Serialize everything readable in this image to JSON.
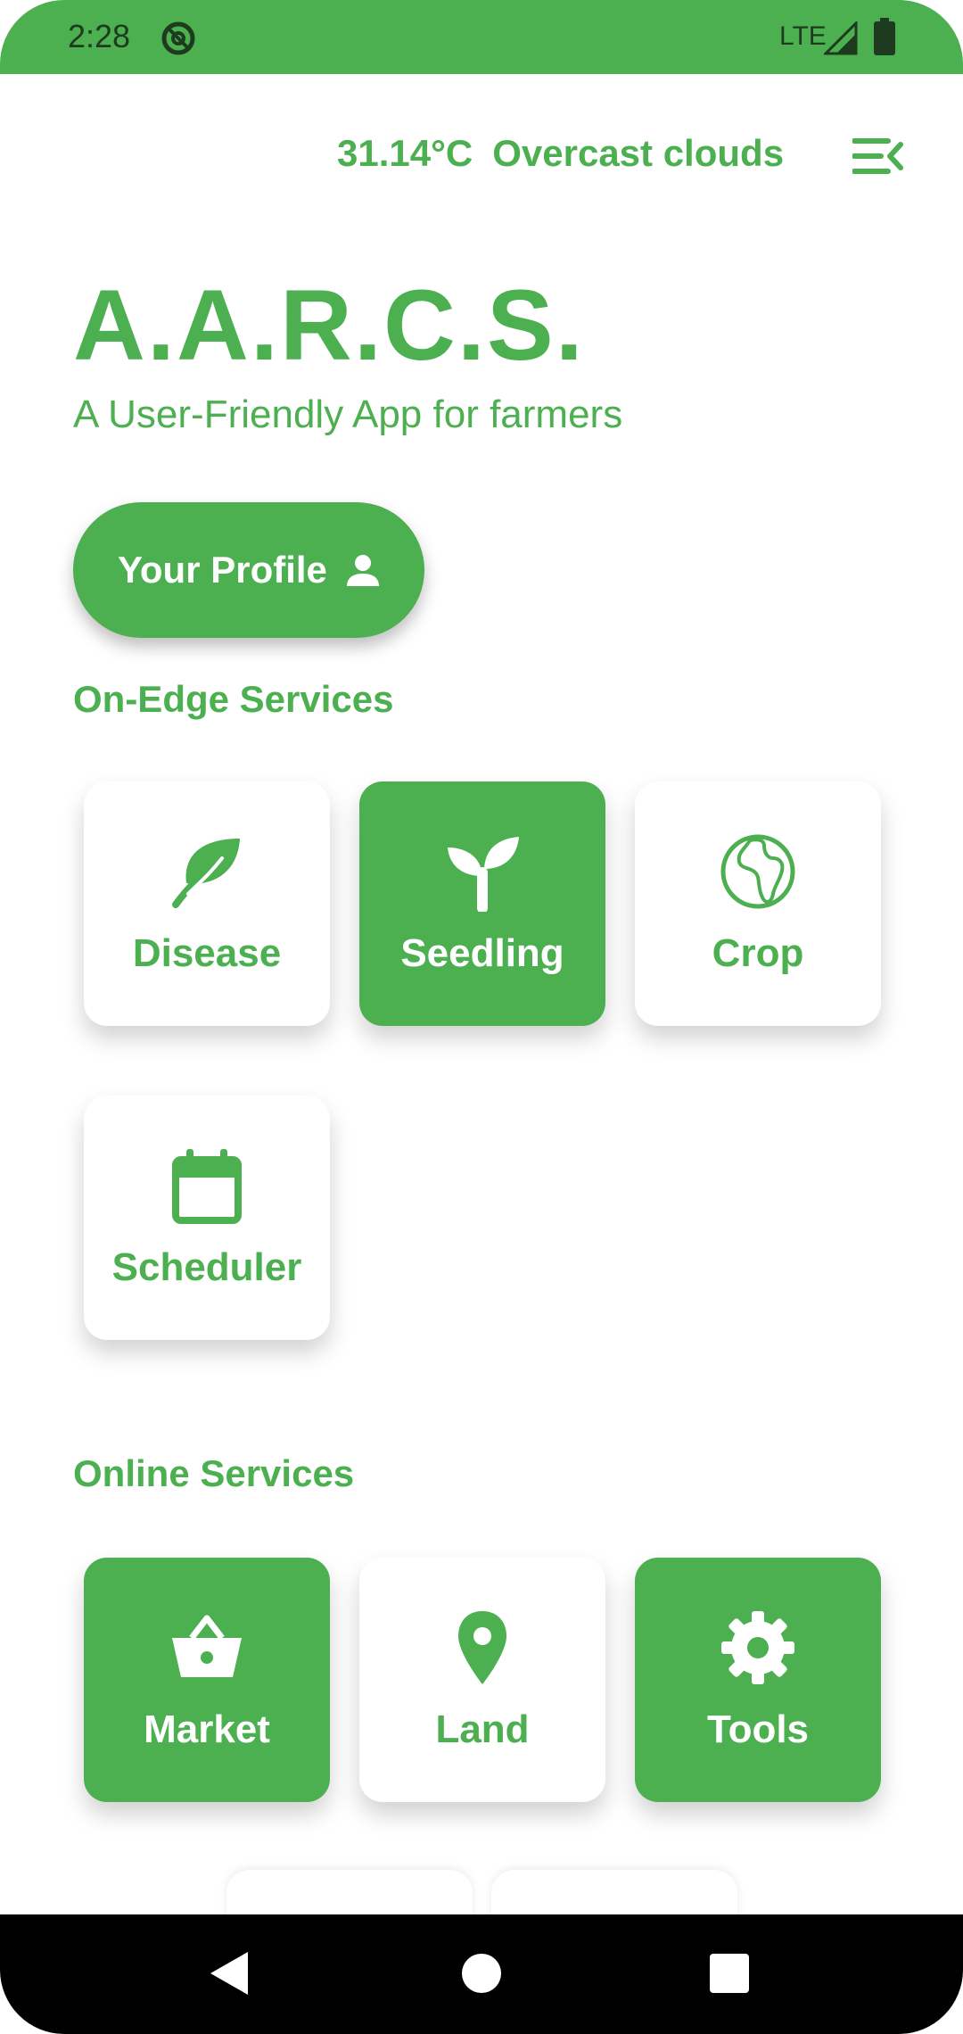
{
  "status_bar": {
    "time": "2:28",
    "network": "LTE",
    "icons": [
      "do-not-disturb-icon",
      "signal-icon",
      "battery-icon"
    ]
  },
  "header": {
    "temperature": "31.14°C",
    "condition": "Overcast clouds",
    "menu_icon": "menu-collapse-icon"
  },
  "app": {
    "title": "A.A.R.C.S.",
    "subtitle": "A User-Friendly App for farmers"
  },
  "profile_button": {
    "label": "Your Profile",
    "icon": "person-icon"
  },
  "on_edge_services": {
    "title": "On-Edge Services",
    "items": [
      {
        "label": "Disease",
        "icon": "leaf-icon",
        "style": "white"
      },
      {
        "label": "Seedling",
        "icon": "sprout-icon",
        "style": "green"
      },
      {
        "label": "Crop",
        "icon": "globe-africa-icon",
        "style": "white"
      },
      {
        "label": "Scheduler",
        "icon": "calendar-icon",
        "style": "white"
      }
    ]
  },
  "online_services": {
    "title": "Online Services",
    "items": [
      {
        "label": "Market",
        "icon": "basket-icon",
        "style": "green"
      },
      {
        "label": "Land",
        "icon": "location-pin-icon",
        "style": "white"
      },
      {
        "label": "Tools",
        "icon": "gear-icon",
        "style": "green"
      }
    ]
  },
  "colors": {
    "primary": "#4CAF50",
    "background": "#FFFFFF",
    "nav_bar": "#000000"
  }
}
